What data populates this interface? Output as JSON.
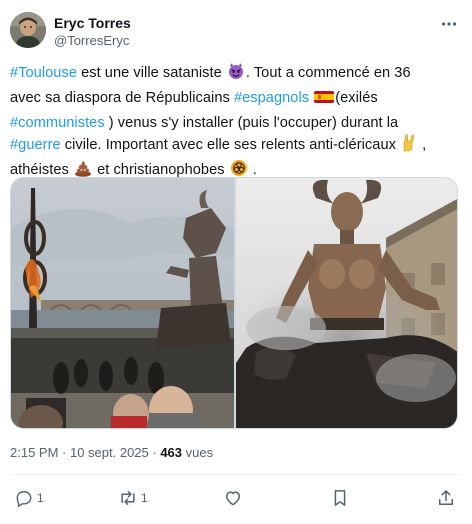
{
  "author": {
    "display_name": "Eryc Torres",
    "handle": "@TorresEryc"
  },
  "tweet": {
    "lines": [
      [
        {
          "t": "tag",
          "v": "#Toulouse"
        },
        {
          "t": "text",
          "v": " est une ville sataniste "
        },
        {
          "t": "emoji",
          "v": "devil-emoji"
        },
        {
          "t": "text",
          "v": ". Tout a commencé en 36"
        }
      ],
      [
        {
          "t": "text",
          "v": "avec sa diaspora de Républicains "
        },
        {
          "t": "tag",
          "v": "#espagnols"
        },
        {
          "t": "text",
          "v": " "
        },
        {
          "t": "emoji",
          "v": "spain-flag-emoji"
        },
        {
          "t": "text",
          "v": "(exilés"
        }
      ],
      [
        {
          "t": "tag",
          "v": "#communistes"
        },
        {
          "t": "text",
          "v": " ) venus s'y installer (puis l'occuper) durant la"
        }
      ],
      [
        {
          "t": "tag",
          "v": "#guerre"
        },
        {
          "t": "text",
          "v": " civile. Important avec elle ses relents anti-cléricaux "
        },
        {
          "t": "emoji",
          "v": "horns-hand-emoji"
        },
        {
          "t": "text",
          "v": " ,"
        }
      ],
      [
        {
          "t": "text",
          "v": "athéistes "
        },
        {
          "t": "emoji",
          "v": "poop-emoji"
        },
        {
          "t": "text",
          "v": " et christianophobes "
        },
        {
          "t": "emoji",
          "v": "biohazard-emoji"
        },
        {
          "t": "text",
          "v": " ."
        }
      ]
    ]
  },
  "meta": {
    "time_date": "2:15 PM · 10 sept. 2025 · ",
    "views_count": "463",
    "views_label": " vues"
  },
  "actions": {
    "reply_count": "1",
    "retweet_count": "1"
  },
  "colors": {
    "link": "#1d9bf0",
    "text": "#0f1419",
    "secondary": "#536471",
    "border": "#cfd9de"
  },
  "icons": {
    "more": "more-dots-icon",
    "reply": "reply-icon",
    "retweet": "retweet-icon",
    "like": "heart-icon",
    "bookmark": "bookmark-icon",
    "share": "share-icon"
  }
}
